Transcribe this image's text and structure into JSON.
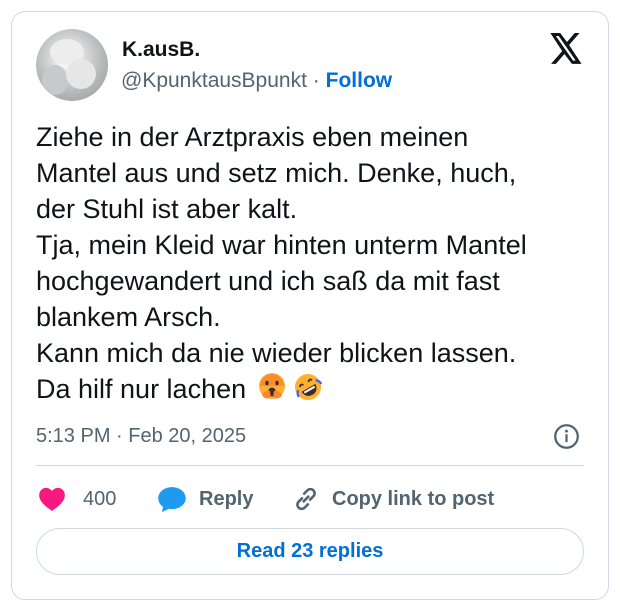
{
  "author": {
    "display_name": "K.ausB.",
    "handle": "@KpunktausBpunkt",
    "separator": "·",
    "follow_label": "Follow"
  },
  "tweet": {
    "lines": [
      "Ziehe in der Arztpraxis eben meinen",
      "Mantel aus und setz mich. Denke, huch,",
      "der Stuhl ist aber kalt.",
      "Tja, mein Kleid war hinten unterm Mantel",
      "hochgewandert und ich saß da mit fast",
      "blankem Arsch.",
      "Kann mich da nie wieder blicken lassen.",
      "Da hilf nur lachen"
    ],
    "emojis": [
      "face-with-hand-over-mouth-emoji",
      "rolling-on-the-floor-laughing-emoji"
    ],
    "timestamp": "5:13 PM · Feb 20, 2025"
  },
  "actions": {
    "like_count": "400",
    "reply_label": "Reply",
    "copy_label": "Copy link to post",
    "read_replies_label": "Read 23 replies"
  },
  "colors": {
    "like": "#f91880",
    "reply": "#1d9bf0",
    "link": "#006fd6",
    "muted": "#536471",
    "border": "#cfd9de"
  }
}
